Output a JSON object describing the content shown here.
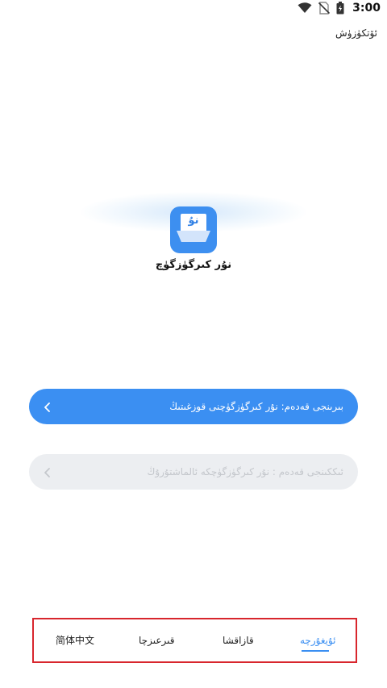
{
  "status_bar": {
    "time": "3:00",
    "icons": [
      "wifi-icon",
      "no-sim-icon",
      "battery-icon"
    ]
  },
  "header": {
    "skip_label": "ئۆتكۈزۈش"
  },
  "app": {
    "logo_text": "نۇ",
    "name": "نۇر كىرگۈزگۈچ"
  },
  "steps": {
    "enable_label": "بىرىنجى قەدەم: نۇر كىرگۈزگۈچنى قوزغىتىڭ",
    "switch_label": "ئىككىنجى قەدەم : نۇر كىرگۈزگۈچكە ئالماشتۇرۇڭ"
  },
  "languages": {
    "zh": "简体中文",
    "ky": "قىرعىزچا",
    "kk": "قازاقشا",
    "ug": "ئۇيغۇرچە",
    "selected": "ug"
  },
  "colors": {
    "accent": "#3b8ff2",
    "disabled_bg": "#eceef1",
    "highlight_border": "#d8262d"
  }
}
